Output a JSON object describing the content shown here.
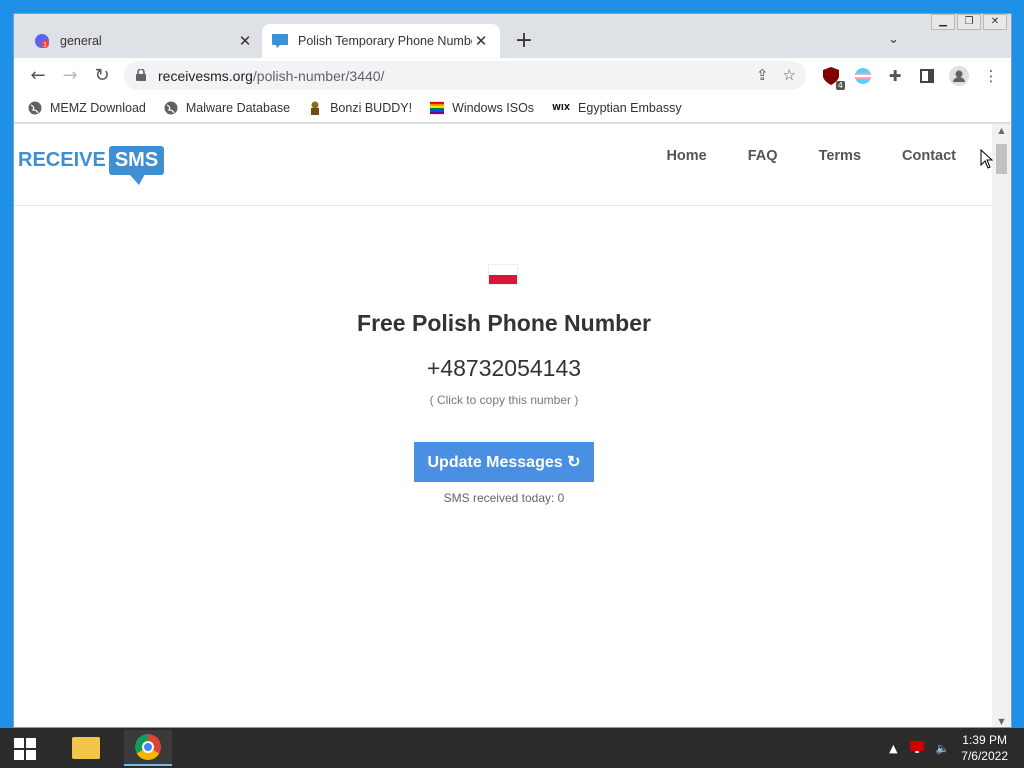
{
  "browser": {
    "tabs": [
      {
        "title": "general",
        "close": "✕"
      },
      {
        "title": "Polish Temporary Phone Number",
        "close": "✕"
      }
    ],
    "new_tab": "+",
    "address": {
      "host": "receivesms.org",
      "path": "/polish-number/3440/"
    },
    "bookmarks": [
      "MEMZ Download",
      "Malware Database",
      "Bonzi BUDDY!",
      "Windows ISOs",
      "Egyptian Embassy"
    ],
    "extension_badge": "4"
  },
  "site": {
    "logo_left": "RECEIVE",
    "logo_right": "SMS",
    "nav": [
      "Home",
      "FAQ",
      "Terms",
      "Contact"
    ]
  },
  "main": {
    "heading": "Free Polish Phone Number",
    "phone": "+48732054143",
    "copy_hint": "( Click to copy this number )",
    "update_button": "Update Messages ↻",
    "sms_count": "SMS received today: 0"
  },
  "taskbar": {
    "time": "1:39 PM",
    "date": "7/6/2022"
  },
  "colors": {
    "accent": "#4a90e2",
    "logo_blue": "#3f8fd3",
    "flag_red": "#dc143c"
  }
}
